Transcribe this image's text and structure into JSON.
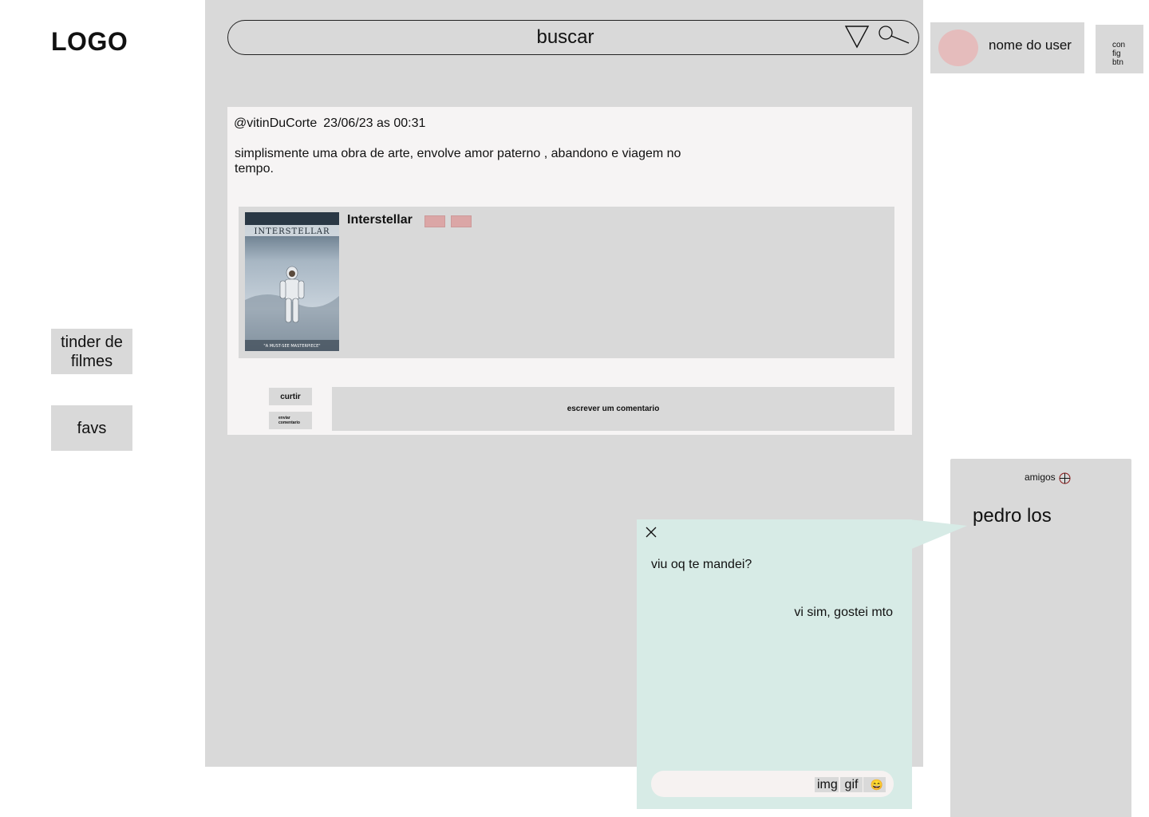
{
  "sidebar": {
    "logo": "LOGO",
    "items": [
      {
        "label": "tinder de filmes"
      },
      {
        "label": "favs"
      }
    ]
  },
  "search": {
    "placeholder": "buscar",
    "icons": [
      "filter-icon",
      "search-icon"
    ]
  },
  "user": {
    "name": "nome do user",
    "config_button": "con fig btn",
    "avatar_color": "#e5bcbc"
  },
  "post": {
    "handle": "@vitinDuCorte",
    "date": "23/06/23 as 00:31",
    "text": "simplismente uma obra de arte, envolve amor paterno , abandono e viagem no tempo.",
    "movie": {
      "title": "Interstellar",
      "poster_title": "INTERSTELLAR",
      "poster_tagline": "\"A MUST-SEE MASTERPIECE\"",
      "tag_color": "#dba6a6"
    },
    "like_label": "curtir",
    "send_comment_label": "enviar comentario",
    "comment_placeholder": "escrever um comentario"
  },
  "friends": {
    "title": "amigos",
    "list": [
      {
        "name": "pedro los"
      }
    ]
  },
  "chat": {
    "messages": [
      {
        "from": "friend",
        "text": "viu oq te mandei?"
      },
      {
        "from": "me",
        "text": "vi sim, gostei mto"
      }
    ],
    "tools": {
      "img": "img",
      "gif": "gif",
      "emoji": "😄"
    },
    "background": "#d7ebe6"
  },
  "colors": {
    "panel": "#d9d9d9",
    "card": "#f6f4f4",
    "chat": "#d7ebe6",
    "accent_pink": "#e5bcbc"
  }
}
